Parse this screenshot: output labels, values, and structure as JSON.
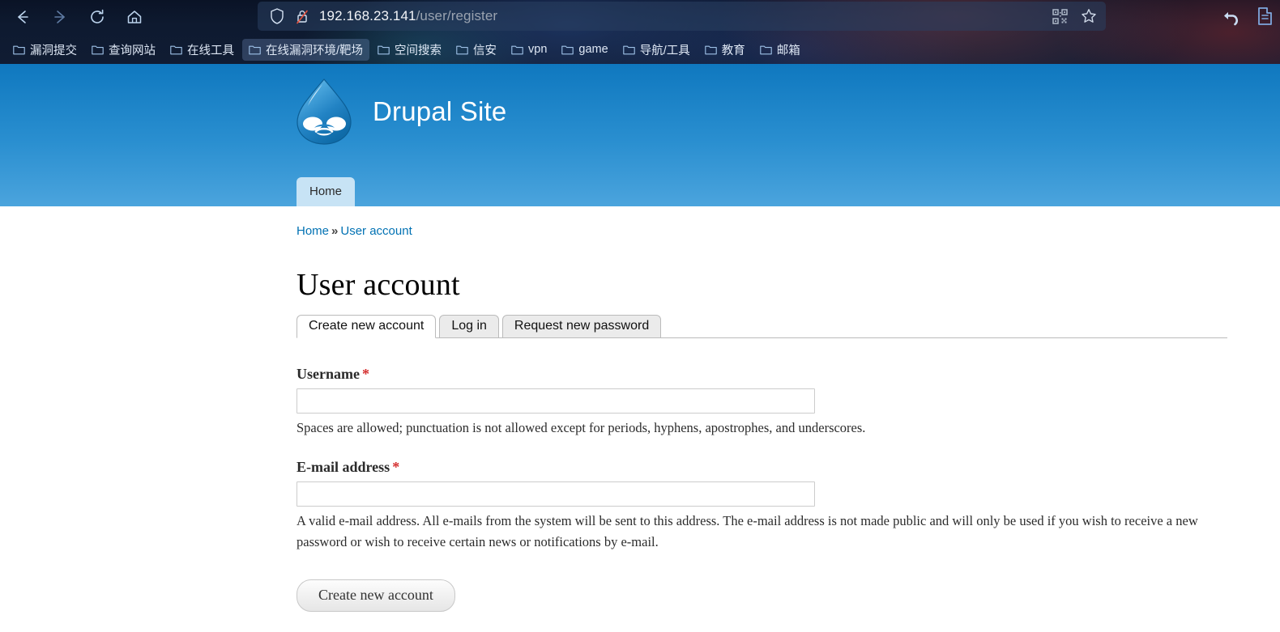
{
  "browser": {
    "nav": {
      "back_icon": "back-arrow-icon",
      "forward_icon": "forward-arrow-icon",
      "reload_icon": "reload-icon",
      "home_icon": "home-icon"
    },
    "url_bar": {
      "shield_icon": "shield-icon",
      "lock_icon": "insecure-lock-icon",
      "host": "192.168.23.141",
      "path": "/user/register",
      "qr_icon": "qr-code-icon",
      "bookmark_icon": "star-icon"
    },
    "right_icons": {
      "undo_icon": "undo-arrow-icon",
      "extension_icon": "extension-icon"
    },
    "bookmarks": [
      {
        "label": "漏洞提交",
        "active": false
      },
      {
        "label": "查询网站",
        "active": false
      },
      {
        "label": "在线工具",
        "active": false
      },
      {
        "label": "在线漏洞环境/靶场",
        "active": true
      },
      {
        "label": "空间搜索",
        "active": false
      },
      {
        "label": "信安",
        "active": false
      },
      {
        "label": "vpn",
        "active": false
      },
      {
        "label": "game",
        "active": false
      },
      {
        "label": "导航/工具",
        "active": false
      },
      {
        "label": "教育",
        "active": false
      },
      {
        "label": "邮箱",
        "active": false
      }
    ]
  },
  "site": {
    "name": "Drupal Site",
    "logo_icon": "drupal-droplet-logo",
    "primary_nav": [
      {
        "label": "Home"
      }
    ]
  },
  "breadcrumb": {
    "home": "Home",
    "separator": "»",
    "current": "User account"
  },
  "page": {
    "title": "User account"
  },
  "tabs": [
    {
      "label": "Create new account",
      "active": true
    },
    {
      "label": "Log in",
      "active": false
    },
    {
      "label": "Request new password",
      "active": false
    }
  ],
  "form": {
    "username": {
      "label": "Username",
      "required_marker": "*",
      "value": "",
      "placeholder": "",
      "description": "Spaces are allowed; punctuation is not allowed except for periods, hyphens, apostrophes, and underscores."
    },
    "email": {
      "label": "E-mail address",
      "required_marker": "*",
      "value": "",
      "placeholder": "",
      "description": "A valid e-mail address. All e-mails from the system will be sent to this address. The e-mail address is not made public and will only be used if you wish to receive a new password or wish to receive certain news or notifications by e-mail."
    },
    "submit_label": "Create new account"
  },
  "colors": {
    "header_top": "#0f78bf",
    "header_bottom": "#4ba4dd",
    "link": "#0071b3",
    "required": "#d42d2d",
    "nav_tab_bg": "#c7e3f5"
  }
}
